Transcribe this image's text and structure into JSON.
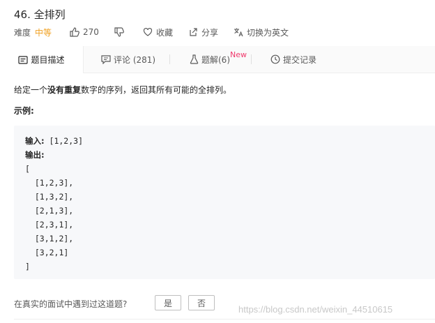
{
  "problem": {
    "title": "46. 全排列",
    "difficulty_label": "难度",
    "difficulty_value": "中等",
    "likes": "270",
    "favorite_label": "收藏",
    "share_label": "分享",
    "switch_lang_label": "切换为英文"
  },
  "tabs": [
    {
      "label": "题目描述",
      "icon": "doc-icon"
    },
    {
      "label": "评论 (281)",
      "icon": "comment-icon"
    },
    {
      "label": "题解(6)",
      "icon": "flask-icon"
    },
    {
      "label": "提交记录",
      "icon": "clock-icon"
    }
  ],
  "new_badge": "New",
  "description": {
    "pre": "给定一个",
    "bold": "没有重复",
    "post": "数字的序列，返回其所有可能的全排列。"
  },
  "example_label": "示例:",
  "example": {
    "input_label": "输入:",
    "input_value": " [1,2,3]",
    "output_label": "输出:",
    "output_lines": [
      "[",
      "  [1,2,3],",
      "  [1,3,2],",
      "  [2,1,3],",
      "  [2,3,1],",
      "  [3,1,2],",
      "  [3,2,1]",
      "]"
    ]
  },
  "feedback": {
    "question": "在真实的面试中遇到过这道题?",
    "yes": "是",
    "no": "否"
  },
  "watermark": "https://blog.csdn.net/weixin_44510615",
  "colors": {
    "difficulty": "#f0a020",
    "new_badge": "#f0386b",
    "code_bg": "#f7f8fa"
  }
}
